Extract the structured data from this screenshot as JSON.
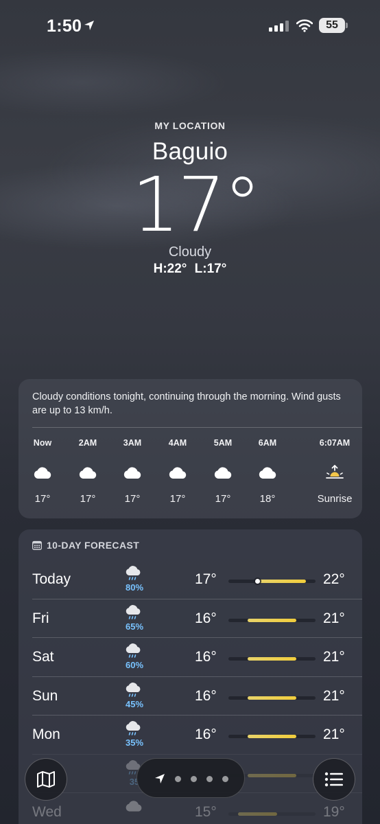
{
  "status_bar": {
    "time": "1:50",
    "battery": "55"
  },
  "hero": {
    "location_label": "MY LOCATION",
    "city": "Baguio",
    "temperature": "17°",
    "condition": "Cloudy",
    "high_low": "H:22° L:17°"
  },
  "hourly": {
    "description": "Cloudy conditions tonight, continuing through the morning. Wind gusts are up to 13 km/h.",
    "items": [
      {
        "label": "Now",
        "icon": "cloud-icon",
        "temp": "17°"
      },
      {
        "label": "2AM",
        "icon": "cloud-icon",
        "temp": "17°"
      },
      {
        "label": "3AM",
        "icon": "cloud-icon",
        "temp": "17°"
      },
      {
        "label": "4AM",
        "icon": "cloud-icon",
        "temp": "17°"
      },
      {
        "label": "5AM",
        "icon": "cloud-icon",
        "temp": "17°"
      },
      {
        "label": "6AM",
        "icon": "cloud-icon",
        "temp": "18°"
      },
      {
        "label": "6:07AM",
        "icon": "sunrise-icon",
        "temp": "Sunrise"
      }
    ]
  },
  "forecast": {
    "title": "10-DAY FORECAST",
    "range_min": 14,
    "range_max": 23,
    "days": [
      {
        "day": "Today",
        "icon": "rain-cloud-icon",
        "pop": "80%",
        "low": "17°",
        "high": "22°",
        "low_value": 17,
        "high_value": 22,
        "current_value": 17
      },
      {
        "day": "Fri",
        "icon": "rain-cloud-icon",
        "pop": "65%",
        "low": "16°",
        "high": "21°",
        "low_value": 16,
        "high_value": 21
      },
      {
        "day": "Sat",
        "icon": "rain-cloud-icon",
        "pop": "60%",
        "low": "16°",
        "high": "21°",
        "low_value": 16,
        "high_value": 21
      },
      {
        "day": "Sun",
        "icon": "rain-cloud-icon",
        "pop": "45%",
        "low": "16°",
        "high": "21°",
        "low_value": 16,
        "high_value": 21
      },
      {
        "day": "Mon",
        "icon": "rain-cloud-icon",
        "pop": "35%",
        "low": "16°",
        "high": "21°",
        "low_value": 16,
        "high_value": 21
      },
      {
        "day": "",
        "icon": "rain-cloud-icon",
        "pop": "35",
        "low": "",
        "high": "",
        "low_value": 16,
        "high_value": 21
      },
      {
        "day": "Wed",
        "icon": "cloud-icon",
        "pop": "",
        "low": "15°",
        "high": "19°",
        "low_value": 15,
        "high_value": 19
      }
    ]
  },
  "bottom_bar": {
    "map_button": "map-icon",
    "list_button": "list-icon",
    "page_indicator": {
      "current": "location-arrow-icon",
      "dots": 4
    }
  },
  "colors": {
    "precip": "#79c3ff",
    "temp_bar": "#f1cd3c",
    "card_bg": "#4a4e5a"
  }
}
